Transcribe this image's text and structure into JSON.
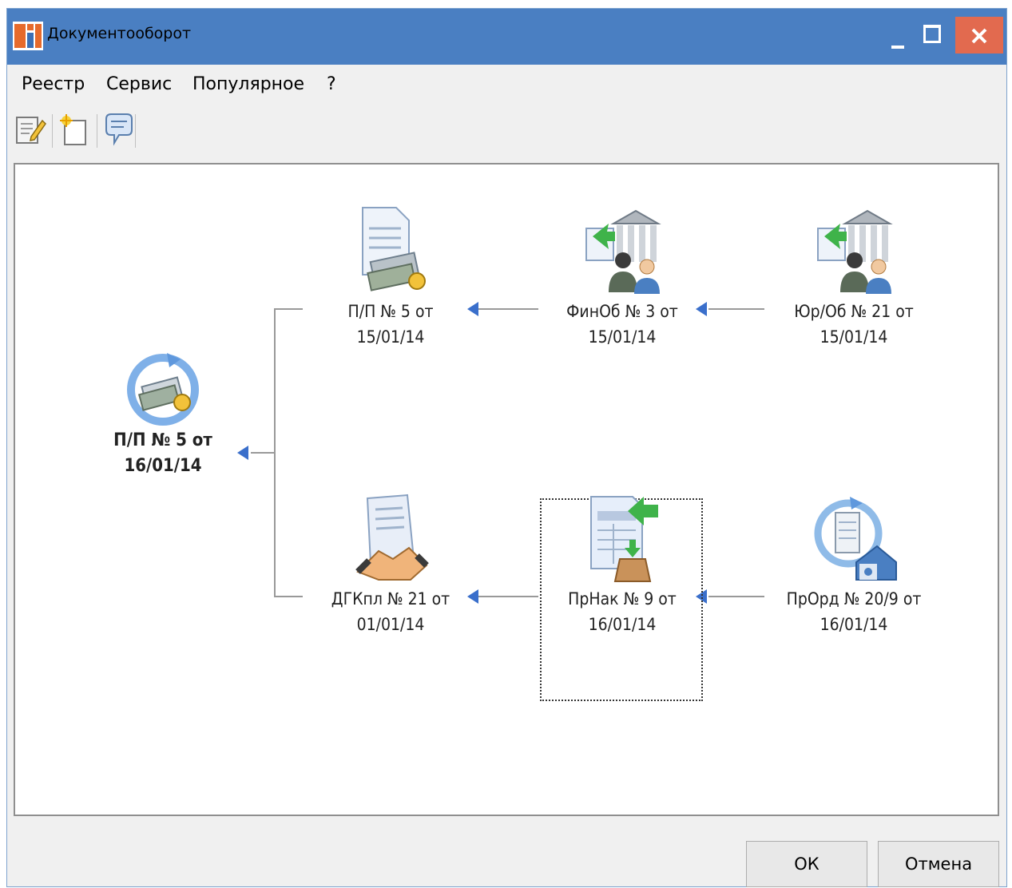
{
  "window": {
    "title": "Документооборот",
    "accent": "#4a7fc2",
    "close_color": "#e26a4f",
    "icons": [
      "app-icon",
      "minimize-icon",
      "maximize-icon",
      "close-icon"
    ]
  },
  "menu": {
    "items": [
      "Реестр",
      "Сервис",
      "Популярное",
      "?"
    ]
  },
  "toolbar": {
    "icons": [
      "edit-document-icon",
      "new-document-icon",
      "comment-icon"
    ]
  },
  "diagram": {
    "root": {
      "line1": "П/П  № 5 от",
      "line2": "16/01/14",
      "icon": "payment-order-icon"
    },
    "nodes": [
      {
        "line1": "П/П  № 5 от",
        "line2": "15/01/14",
        "icon": "payment-document-icon"
      },
      {
        "line1": "ФинОб  № 3 от",
        "line2": "15/01/14",
        "icon": "bank-people-icon"
      },
      {
        "line1": "Юр/Об  № 21 от",
        "line2": "15/01/14",
        "icon": "bank-people-icon"
      },
      {
        "line1": "ДГКпл  № 21 от",
        "line2": "01/01/14",
        "icon": "contract-handshake-icon"
      },
      {
        "line1": "ПрНак  № 9 от",
        "line2": "16/01/14",
        "icon": "invoice-box-icon",
        "selected": true
      },
      {
        "line1": "ПрОрд  № 20/9 от",
        "line2": "16/01/14",
        "icon": "warehouse-order-icon"
      }
    ]
  },
  "buttons": {
    "ok": "ОК",
    "cancel": "Отмена"
  }
}
